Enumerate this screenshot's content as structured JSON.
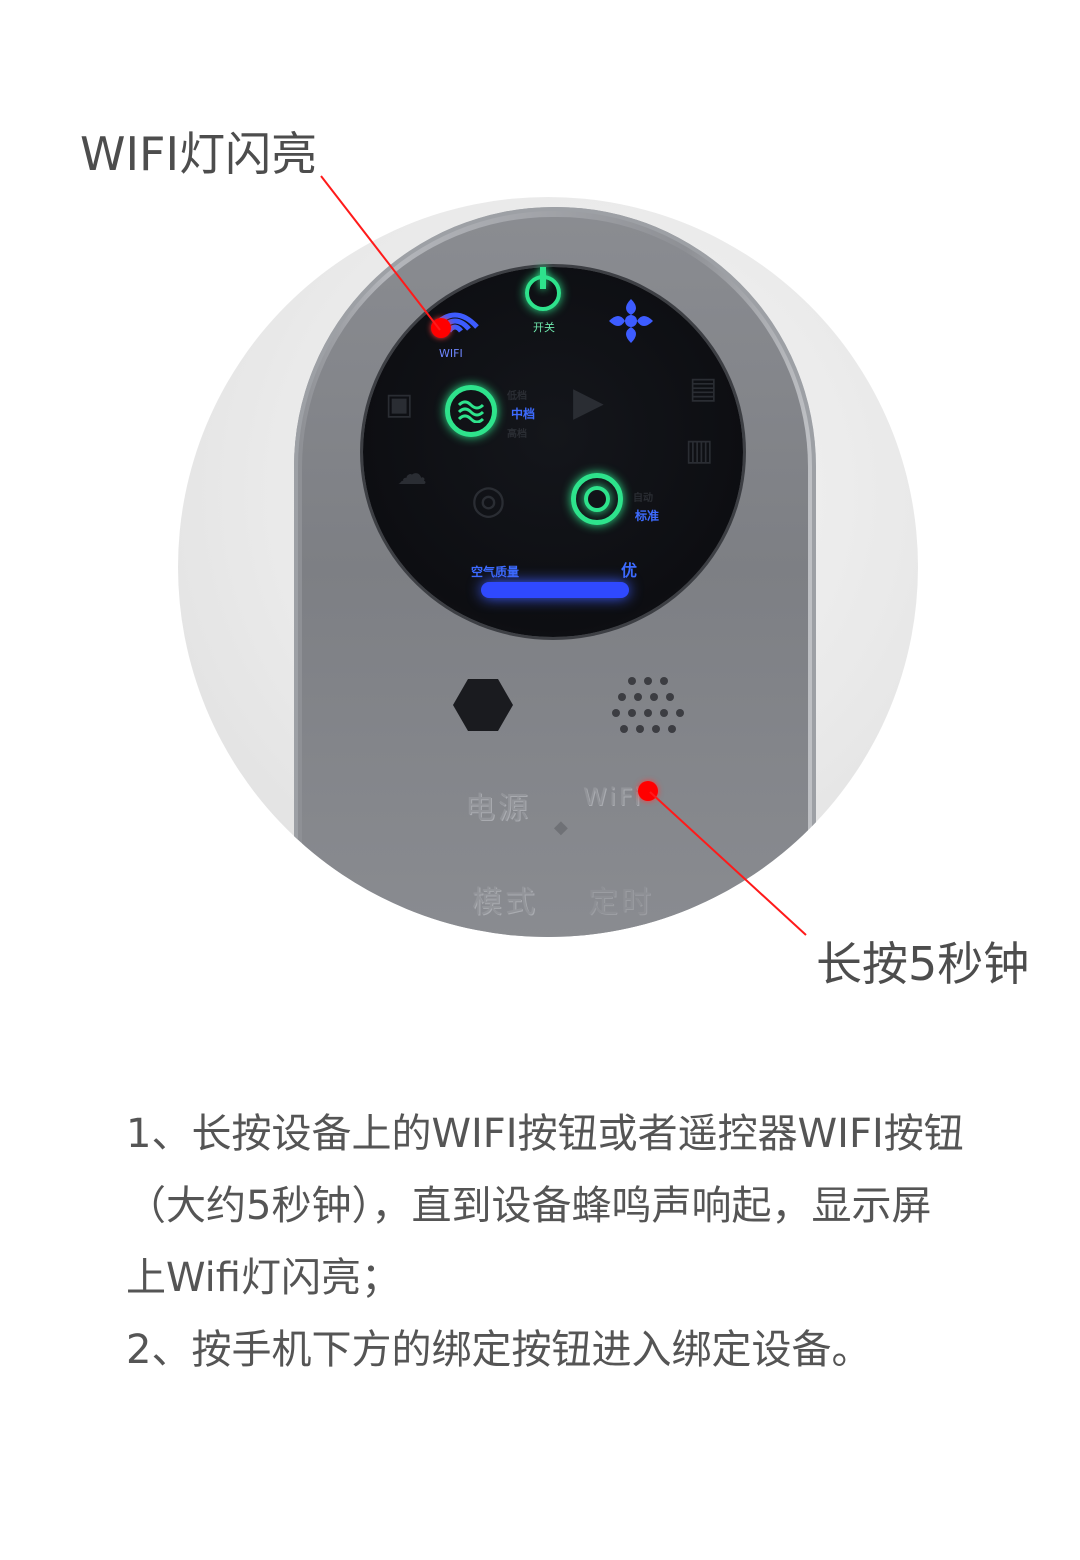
{
  "annotations": {
    "top": "WIFI灯闪亮",
    "bottom": "长按5秒钟"
  },
  "device": {
    "power_label": "开关",
    "wifi_label": "WIFI",
    "air_quality_label": "空气质量",
    "air_quality_value": "优",
    "level_labels": [
      "低档",
      "中档",
      "高档"
    ],
    "mode_labels": [
      "自动",
      "标准"
    ],
    "button_power": "电源",
    "button_wifi": "WiFi",
    "button_mode": "模式",
    "button_timer": "定时",
    "indicator_color": "#2ee38c",
    "wifi_color": "#3d5cff",
    "marker_color": "#ff0000"
  },
  "instructions": {
    "line1": "1、长按设备上的WIFI按钮或者遥控器WIFI按钮",
    "line2": "（大约5秒钟），直到设备蜂鸣声响起，显示屏",
    "line3": "上Wifi灯闪亮；",
    "line4": "2、按手机下方的绑定按钮进入绑定设备。"
  }
}
